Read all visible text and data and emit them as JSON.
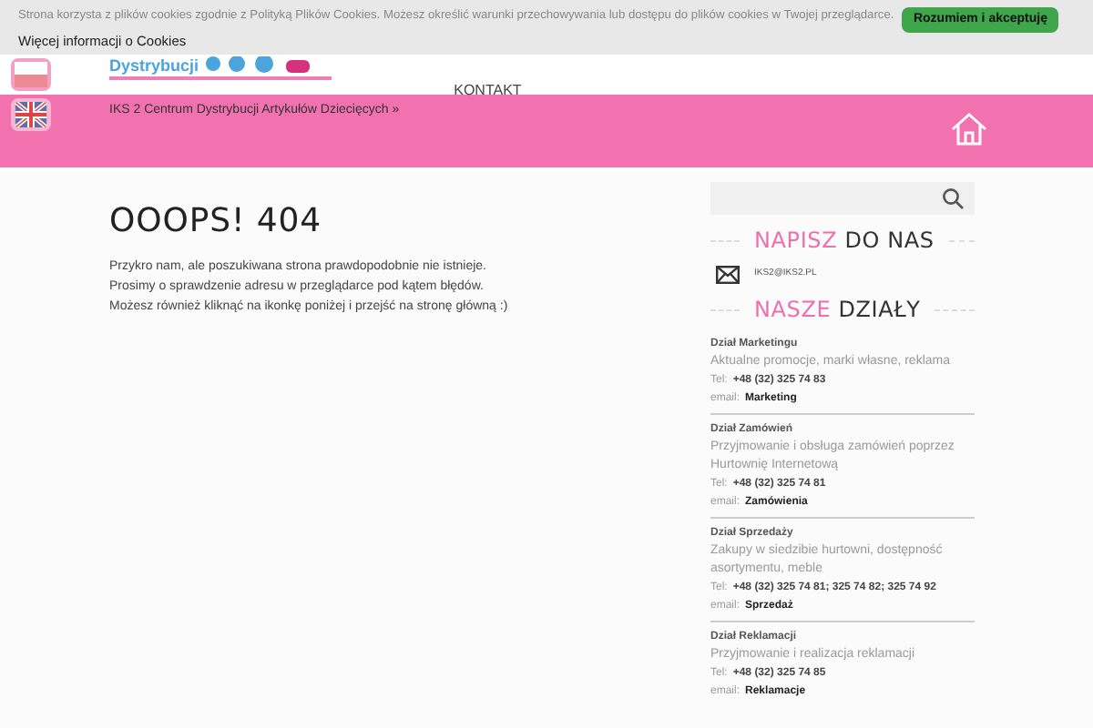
{
  "cookie_bar": {
    "text": "Strona korzysta z plików cookies zgodnie z Polityką Plików Cookies. Możesz określić warunki przechowywania lub dostępu do plików cookies w Twojej przeglądarce.",
    "link": "Więcej informacji o Cookies",
    "button": "Rozumiem i akceptuję"
  },
  "header": {
    "logo_text": "Dystrybucji",
    "languages": [
      {
        "kind": "pl",
        "selected": true
      },
      {
        "kind": "uk",
        "selected": false
      }
    ],
    "breadcrumb": "IKS 2 Centrum Dystrybucji Artykułów Dziecięcych »",
    "nav": [
      "KONTAKT"
    ]
  },
  "main": {
    "title": "OOOPS! 404",
    "lines": [
      "Przykro nam, ale poszukiwana strona prawdopodobnie nie istnieje.",
      "Prosimy o sprawdzenie adresu w przeglądarce pod kątem błędów.",
      "Możesz również kliknąć na ikonkę poniżej i przejść na stronę główną :)"
    ]
  },
  "sidebar": {
    "contact_heading": [
      "NAPISZ",
      "DO NAS"
    ],
    "email": "IKS2@IKS2.PL",
    "departments_heading": [
      "NASZE",
      "DZIAŁY"
    ],
    "departments": [
      {
        "name": "Dział Marketingu",
        "description": "Aktualne promocje, marki własne, reklama",
        "tel_label": "Tel:",
        "tel": "+48 (32) 325 74 83",
        "email_label": "email:",
        "email": "Marketing"
      },
      {
        "name": "Dział Zamówień",
        "description": "Przyjmowanie i obsługa zamówień poprzez Hurtownię Internetową",
        "tel_label": "Tel:",
        "tel": "+48 (32) 325 74 81",
        "email_label": "email:",
        "email": "Zamówienia"
      },
      {
        "name": "Dział Sprzedaży",
        "description": "Zakupy w siedzibie hurtowni, dostępność asortymentu, meble",
        "tel_label": "Tel:",
        "tel": "+48 (32) 325 74 81; 325 74 82; 325 74 92",
        "email_label": "email:",
        "email": "Sprzedaż"
      },
      {
        "name": "Dział Reklamacji",
        "description": "Przyjmowanie i realizacja reklamacji",
        "tel_label": "Tel:",
        "tel": "+48 (32) 325 74 85",
        "email_label": "email:",
        "email": "Reklamacje"
      }
    ]
  }
}
